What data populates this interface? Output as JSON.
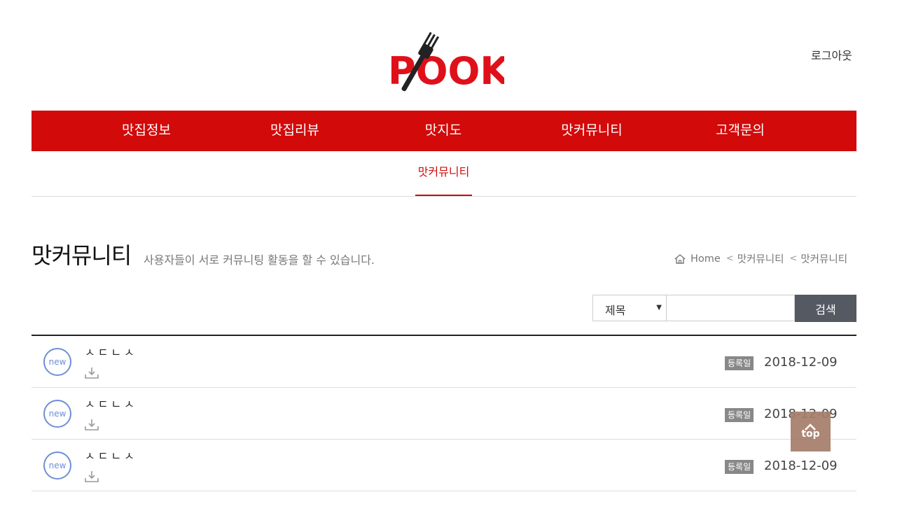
{
  "header": {
    "logo_text": "POOK",
    "logout_label": "로그아웃"
  },
  "gnb": {
    "items": [
      {
        "label": "맛집정보"
      },
      {
        "label": "맛집리뷰"
      },
      {
        "label": "맛지도"
      },
      {
        "label": "맛커뮤니티"
      },
      {
        "label": "고객문의"
      }
    ]
  },
  "subnav": {
    "active_label": "맛커뮤니티"
  },
  "page": {
    "title": "맛커뮤니티",
    "description": "사용자들이 서로 커뮤니팅 활동을 할 수 있습니다."
  },
  "breadcrumb": {
    "home_icon": "home-icon",
    "items": [
      "Home",
      "맛커뮤니티",
      "맛커뮤니티"
    ]
  },
  "search": {
    "select_value": "제목",
    "input_value": "",
    "button_label": "검색"
  },
  "posts": [
    {
      "badge": "new",
      "title": "ㅅㄷㄴㅅ",
      "reg_label": "등록일",
      "date": "2018-12-09"
    },
    {
      "badge": "new",
      "title": "ㅅㄷㄴㅅ",
      "reg_label": "등록일",
      "date": "2018-12-09"
    },
    {
      "badge": "new",
      "title": "ㅅㄷㄴㅅ",
      "reg_label": "등록일",
      "date": "2018-12-09"
    }
  ],
  "top_button": {
    "label": "top"
  },
  "colors": {
    "brand_red": "#d20a0a",
    "new_badge_blue": "#6e8fd6",
    "search_button": "#555a62",
    "top_button": "#a67e6b"
  }
}
